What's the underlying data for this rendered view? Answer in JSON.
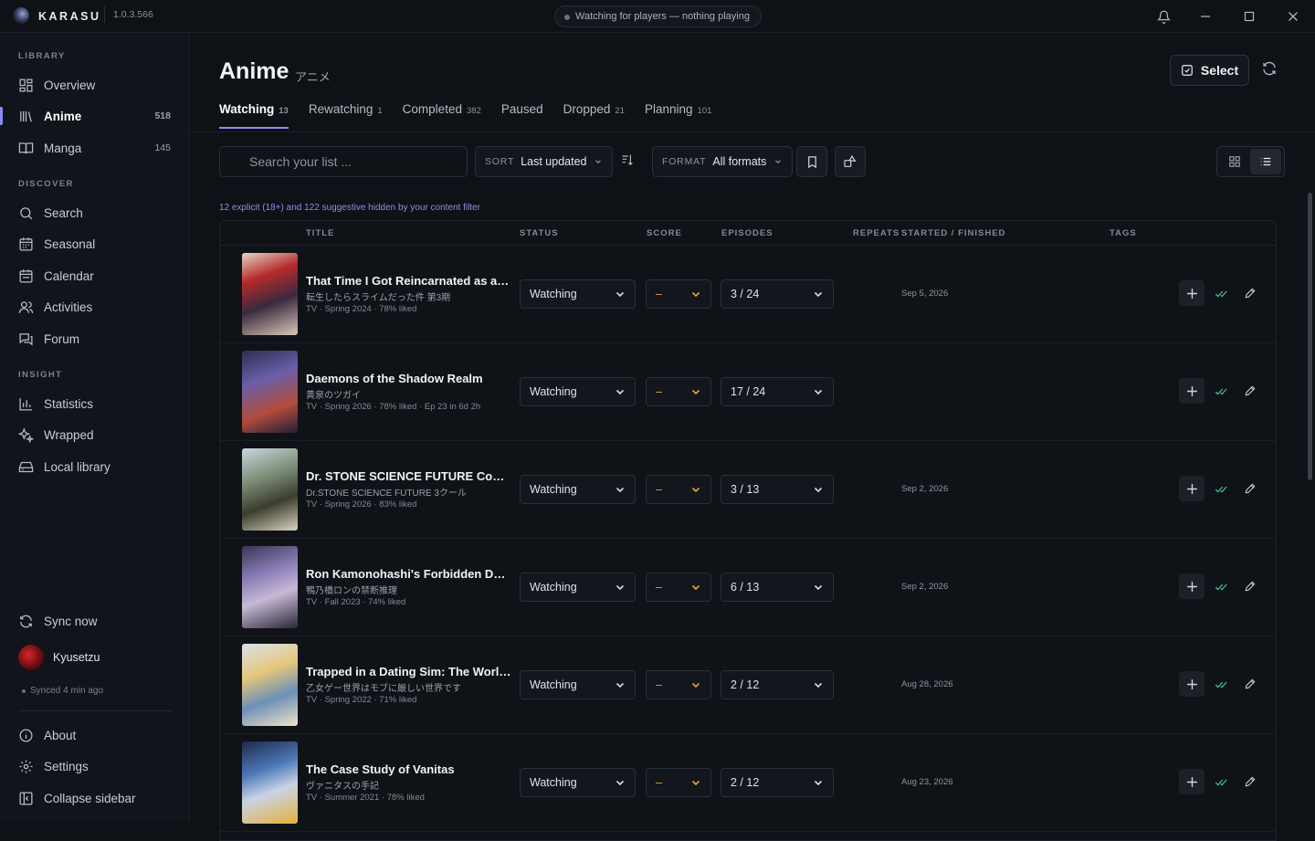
{
  "app": {
    "brand": "KARASU",
    "version": "1.0.3.566",
    "player_status": "Watching for players — nothing playing"
  },
  "sidebar": {
    "sections": {
      "library": "LIBRARY",
      "discover": "DISCOVER",
      "insight": "INSIGHT"
    },
    "library": [
      {
        "label": "Overview",
        "icon": "overview-icon",
        "count": ""
      },
      {
        "label": "Anime",
        "icon": "books-icon",
        "count": "518"
      },
      {
        "label": "Manga",
        "icon": "book-icon",
        "count": "145"
      }
    ],
    "discover": [
      {
        "label": "Search",
        "icon": "search-icon"
      },
      {
        "label": "Seasonal",
        "icon": "seasonal-icon"
      },
      {
        "label": "Calendar",
        "icon": "calendar-icon"
      },
      {
        "label": "Activities",
        "icon": "users-icon"
      },
      {
        "label": "Forum",
        "icon": "forum-icon"
      }
    ],
    "insight": [
      {
        "label": "Statistics",
        "icon": "chart-icon"
      },
      {
        "label": "Wrapped",
        "icon": "sparkle-icon"
      },
      {
        "label": "Local library",
        "icon": "drive-icon"
      }
    ],
    "sync": "Sync now",
    "user": "Kyusetzu",
    "synced": "Synced 4 min ago",
    "footer": [
      {
        "label": "About",
        "icon": "info-icon"
      },
      {
        "label": "Settings",
        "icon": "gear-icon"
      },
      {
        "label": "Collapse sidebar",
        "icon": "collapse-icon"
      }
    ]
  },
  "page": {
    "title": "Anime",
    "subtitle": "アニメ",
    "select": "Select"
  },
  "tabs": [
    {
      "label": "Watching",
      "count": "13"
    },
    {
      "label": "Rewatching",
      "count": "1"
    },
    {
      "label": "Completed",
      "count": "382"
    },
    {
      "label": "Paused",
      "count": ""
    },
    {
      "label": "Dropped",
      "count": "21"
    },
    {
      "label": "Planning",
      "count": "101"
    }
  ],
  "toolbar": {
    "search_placeholder": "Search your list ...",
    "sort_label": "SORT",
    "sort_value": "Last updated",
    "format_label": "FORMAT",
    "format_value": "All formats"
  },
  "filter_note": "12 explicit (18+) and 122 suggestive hidden by your content filter",
  "columns": {
    "title": "TITLE",
    "status": "STATUS",
    "score": "SCORE",
    "episodes": "EPISODES",
    "repeats": "REPEATS",
    "dates": "STARTED / FINISHED",
    "tags": "TAGS"
  },
  "rows": [
    {
      "title": "That Time I Got Reincarnated as a Sl...",
      "native": "転生したらスライムだった件 第3期",
      "meta": "TV · Spring 2024 · 78% liked",
      "status": "Watching",
      "score": "–",
      "episodes": "3 / 24",
      "date": "Sep 5, 2026"
    },
    {
      "title": "Daemons of the Shadow Realm",
      "native": "黄泉のツガイ",
      "meta": "TV · Spring 2026 · 78% liked · Ep 23 in 6d 2h",
      "status": "Watching",
      "score": "–",
      "episodes": "17 / 24",
      "date": ""
    },
    {
      "title": "Dr. STONE SCIENCE FUTURE Cour 3",
      "native": "Dr.STONE SCIENCE FUTURE 3クール",
      "meta": "TV · Spring 2026 · 83% liked",
      "status": "Watching",
      "score": "–",
      "episodes": "3 / 13",
      "date": "Sep 2, 2026"
    },
    {
      "title": "Ron Kamonohashi's Forbidden Ded...",
      "native": "鴨乃橋ロンの禁断推理",
      "meta": "TV · Fall 2023 · 74% liked",
      "status": "Watching",
      "score": "–",
      "episodes": "6 / 13",
      "date": "Sep 2, 2026"
    },
    {
      "title": "Trapped in a Dating Sim: The World ...",
      "native": "乙女ゲー世界はモブに厳しい世界です",
      "meta": "TV · Spring 2022 · 71% liked",
      "status": "Watching",
      "score": "–",
      "episodes": "2 / 12",
      "date": "Aug 28, 2026"
    },
    {
      "title": "The Case Study of Vanitas",
      "native": "ヴァニタスの手記",
      "meta": "TV · Summer 2021 · 78% liked",
      "status": "Watching",
      "score": "–",
      "episodes": "2 / 12",
      "date": "Aug 23, 2026"
    }
  ],
  "colors": {
    "accent": "#8a8df0",
    "done": "#49c48a",
    "score": "#e0a83a"
  }
}
